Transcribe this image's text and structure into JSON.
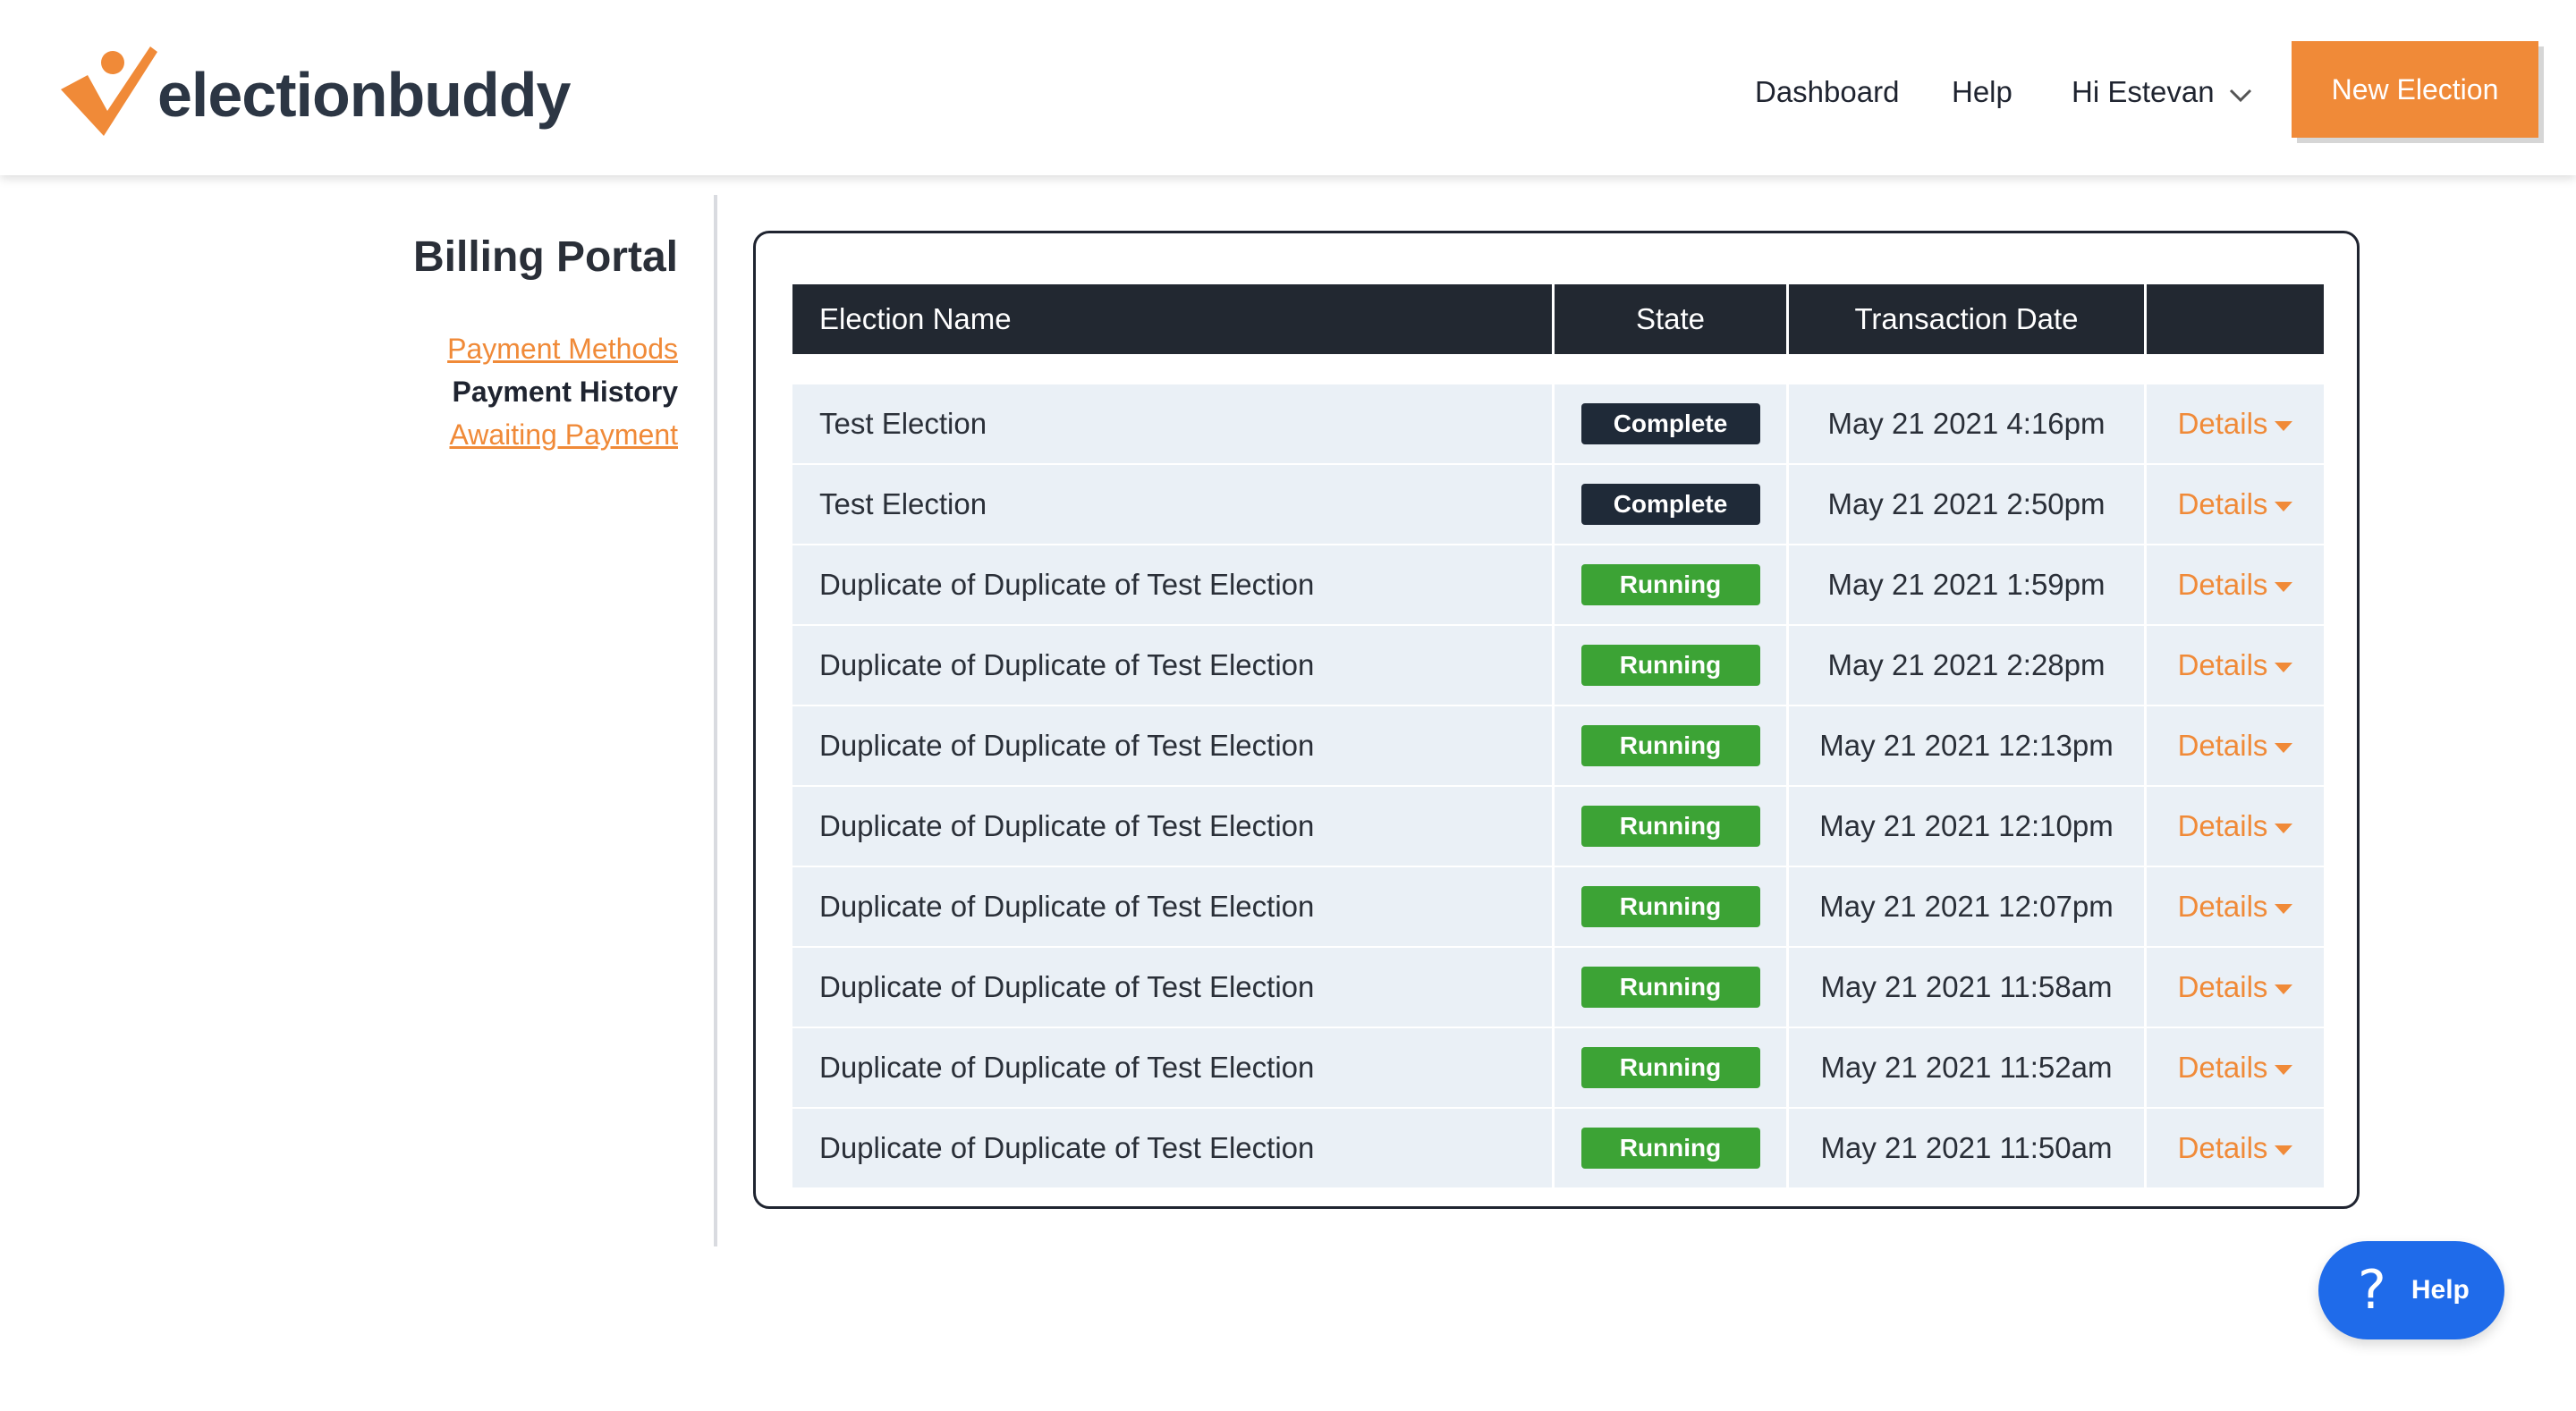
{
  "header": {
    "logo_text": "electionbuddy",
    "logo_icon": "checkmark-person-logo",
    "nav": {
      "dashboard": "Dashboard",
      "help": "Help",
      "user": "Hi Estevan"
    },
    "new_election": "New Election"
  },
  "sidebar": {
    "title": "Billing Portal",
    "links": [
      {
        "label": "Payment Methods",
        "active": false
      },
      {
        "label": "Payment History",
        "active": true
      },
      {
        "label": "Awaiting Payment",
        "active": false
      }
    ]
  },
  "table": {
    "columns": [
      "Election Name",
      "State",
      "Transaction Date",
      ""
    ],
    "rows": [
      {
        "name": "Test Election",
        "state": "Complete",
        "date": "May 21 2021 4:16pm",
        "action": "Details"
      },
      {
        "name": "Test Election",
        "state": "Complete",
        "date": "May 21 2021 2:50pm",
        "action": "Details"
      },
      {
        "name": "Duplicate of Duplicate of Test Election",
        "state": "Running",
        "date": "May 21 2021 1:59pm",
        "action": "Details"
      },
      {
        "name": "Duplicate of Duplicate of Test Election",
        "state": "Running",
        "date": "May 21 2021 2:28pm",
        "action": "Details"
      },
      {
        "name": "Duplicate of Duplicate of Test Election",
        "state": "Running",
        "date": "May 21 2021 12:13pm",
        "action": "Details"
      },
      {
        "name": "Duplicate of Duplicate of Test Election",
        "state": "Running",
        "date": "May 21 2021 12:10pm",
        "action": "Details"
      },
      {
        "name": "Duplicate of Duplicate of Test Election",
        "state": "Running",
        "date": "May 21 2021 12:07pm",
        "action": "Details"
      },
      {
        "name": "Duplicate of Duplicate of Test Election",
        "state": "Running",
        "date": "May 21 2021 11:58am",
        "action": "Details"
      },
      {
        "name": "Duplicate of Duplicate of Test Election",
        "state": "Running",
        "date": "May 21 2021 11:52am",
        "action": "Details"
      },
      {
        "name": "Duplicate of Duplicate of Test Election",
        "state": "Running",
        "date": "May 21 2021 11:50am",
        "action": "Details"
      }
    ]
  },
  "help_widget": {
    "label": "Help",
    "icon": "question-mark-icon"
  },
  "colors": {
    "accent": "#f08a38",
    "header_dark": "#222831",
    "complete_badge": "#1f2a38",
    "running_badge": "#3ca335",
    "row_bg": "#eaf0f6",
    "help_blue": "#1f6bea"
  }
}
